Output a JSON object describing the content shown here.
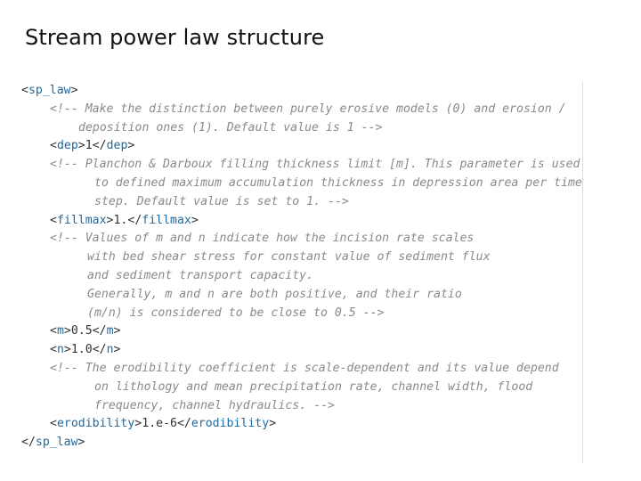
{
  "slide": {
    "title": "Stream power law structure"
  },
  "code": {
    "open_root": "sp_law",
    "comment_dep_1": "<!-- Make the distinction between purely erosive models (0) and erosion /",
    "comment_dep_2": "deposition ones (1). Default value is 1 -->",
    "dep_tag": "dep",
    "dep_value": "1",
    "comment_fill_1": "<!-- Planchon & Darboux filling thickness limit [m]. This parameter is used",
    "comment_fill_2": "to defined maximum accumulation thickness in depression area per time",
    "comment_fill_3": "step. Default value is set to 1. -->",
    "fillmax_tag": "fillmax",
    "fillmax_value": "1.",
    "comment_mn_1": "<!-- Values of m and n indicate how the incision rate scales",
    "comment_mn_2": "with bed shear stress for constant value of sediment flux",
    "comment_mn_3": "and sediment transport capacity.",
    "comment_mn_4": "Generally, m and n are both positive, and their ratio",
    "comment_mn_5": "(m/n) is considered to be close to 0.5 -->",
    "m_tag": "m",
    "m_value": "0.5",
    "n_tag": "n",
    "n_value": "1.0",
    "comment_ero_1": "<!-- The erodibility coefficient is scale-dependent and its value depend",
    "comment_ero_2": "on lithology and mean precipitation rate, channel width, flood",
    "comment_ero_3": "frequency, channel hydraulics. -->",
    "erodibility_tag": "erodibility",
    "erodibility_value": "1.e-6",
    "close_root": "sp_law"
  },
  "colors": {
    "tag": "#1f6a9e",
    "comment": "#8a8a8a",
    "text": "#333333"
  }
}
